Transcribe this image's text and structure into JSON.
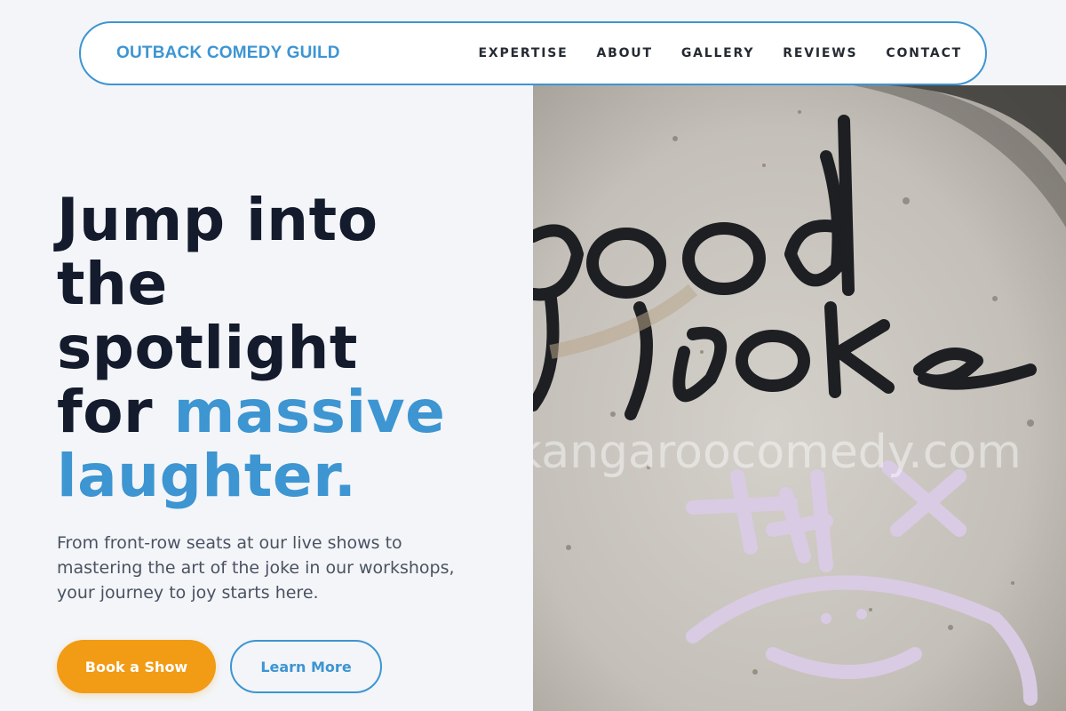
{
  "brand": {
    "name": "OUTBACK COMEDY GUILD"
  },
  "nav": {
    "items": [
      {
        "label": "EXPERTISE"
      },
      {
        "label": "ABOUT"
      },
      {
        "label": "GALLERY"
      },
      {
        "label": "REVIEWS"
      },
      {
        "label": "CONTACT"
      }
    ]
  },
  "hero": {
    "headline_line1": "Jump into",
    "headline_line2": "the",
    "headline_line3": "spotlight",
    "headline_line4_plain": "for ",
    "headline_line4_accent": "massive",
    "headline_line5_accent": "laughter.",
    "subtext": "From front-row seats at our live shows to mastering the art of the joke in our workshops, your journey to joy starts here.",
    "primary_button": "Book a Show",
    "secondary_button": "Learn More"
  },
  "photo": {
    "graffiti_word1": "good",
    "graffiti_word2": "joke",
    "watermark": "kangaroocomedy.com",
    "chalk_text": "+HX"
  },
  "colors": {
    "accent": "#3d95d2",
    "primary_button": "#f29b14",
    "heading": "#141b2d",
    "background": "#f3f5f8"
  }
}
